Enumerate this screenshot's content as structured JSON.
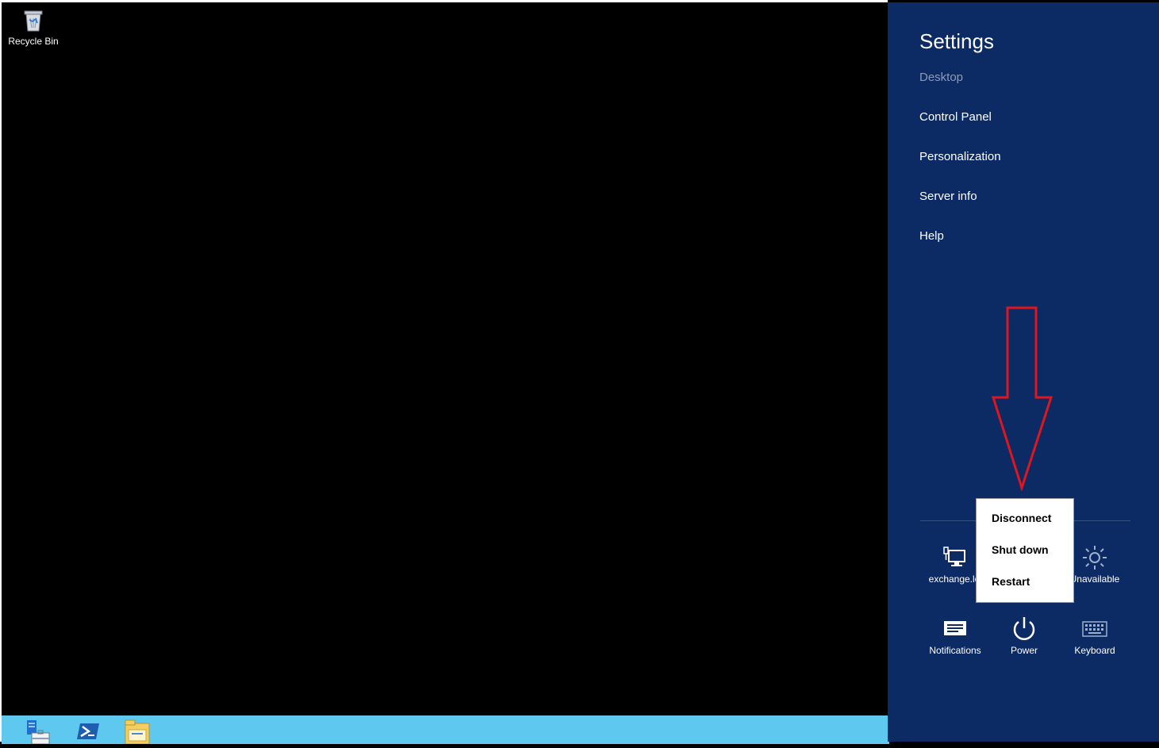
{
  "desktop": {
    "icons": [
      {
        "label": "Recycle Bin",
        "icon": "recycle-bin-icon"
      }
    ]
  },
  "taskbar": {
    "items": [
      {
        "icon": "server-manager-icon"
      },
      {
        "icon": "powershell-icon"
      },
      {
        "icon": "file-explorer-icon"
      }
    ]
  },
  "settings": {
    "title": "Settings",
    "subtitle": "Desktop",
    "links": [
      "Control Panel",
      "Personalization",
      "Server info",
      "Help"
    ],
    "tiles": [
      {
        "label": "exchange.lo",
        "icon": "network-icon"
      },
      {
        "label": "Unavailable",
        "icon": "brightness-icon"
      },
      {
        "label": "Notifications",
        "icon": "notifications-icon"
      },
      {
        "label": "Power",
        "icon": "power-icon"
      },
      {
        "label": "Keyboard",
        "icon": "keyboard-icon"
      }
    ]
  },
  "power_menu": {
    "items": [
      "Disconnect",
      "Shut down",
      "Restart"
    ]
  },
  "annotation": {
    "color": "#e0161e"
  }
}
